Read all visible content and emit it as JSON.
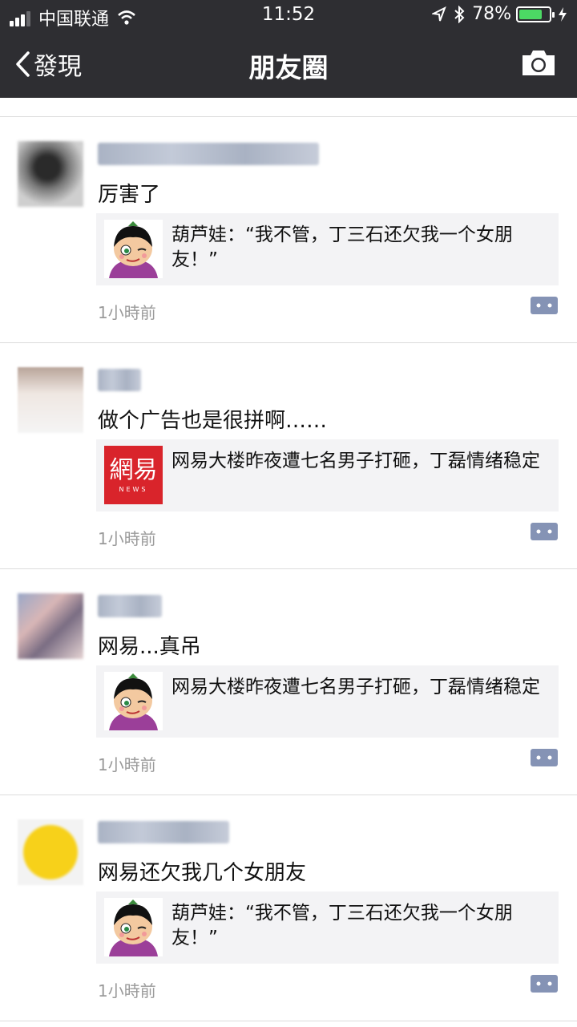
{
  "status_bar": {
    "carrier": "中国联通",
    "time": "11:52",
    "battery": "78%",
    "battery_level": 0.78
  },
  "nav": {
    "back_label": "發現",
    "title": "朋友圈"
  },
  "posts": [
    {
      "text": "厉害了",
      "link_text": "葫芦娃：“我不管，丁三石还欠我一个女朋友！”",
      "time": "1小時前"
    },
    {
      "text": "做个广告也是很拼啊……",
      "link_text": "网易大楼昨夜遭七名男子打砸，丁磊情绪稳定",
      "thumb_text": "網易",
      "thumb_subtext": "NEWS",
      "time": "1小時前"
    },
    {
      "text": "网易...真吊",
      "link_text": "网易大楼昨夜遭七名男子打砸，丁磊情绪稳定",
      "time": "1小時前"
    },
    {
      "text": "网易还欠我几个女朋友",
      "link_text": "葫芦娃：“我不管，丁三石还欠我一个女朋友！”",
      "time": "1小時前"
    }
  ],
  "colors": {
    "header_bg": "#2e2e32",
    "link_card_bg": "#f3f3f5",
    "netease_red": "#d9242b",
    "comment_icon": "#8593b5"
  }
}
